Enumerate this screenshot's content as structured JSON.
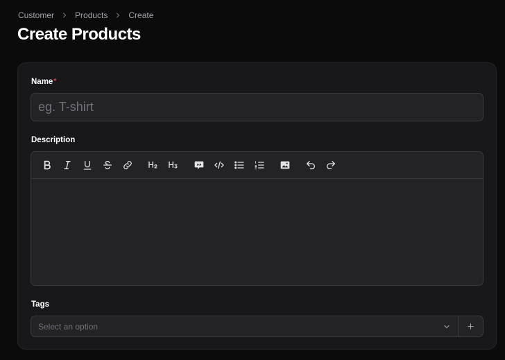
{
  "breadcrumb": {
    "items": [
      "Customer",
      "Products",
      "Create"
    ]
  },
  "page": {
    "title": "Create Products"
  },
  "form": {
    "name": {
      "label": "Name",
      "required_mark": "*",
      "value": "",
      "placeholder": "eg. T-shirt"
    },
    "description": {
      "label": "Description",
      "toolbar_icons": [
        "bold-icon",
        "italic-icon",
        "underline-icon",
        "strikethrough-icon",
        "link-icon",
        "heading-2-icon",
        "heading-3-icon",
        "blockquote-icon",
        "code-block-icon",
        "bullet-list-icon",
        "ordered-list-icon",
        "image-icon",
        "undo-icon",
        "redo-icon"
      ],
      "value": ""
    },
    "tags": {
      "label": "Tags",
      "placeholder": "Select an option"
    }
  },
  "colors": {
    "background": "#0b0b0c",
    "card": "#18181b",
    "input": "#232326",
    "border": "#3a3a3f",
    "required": "#ef4444"
  }
}
